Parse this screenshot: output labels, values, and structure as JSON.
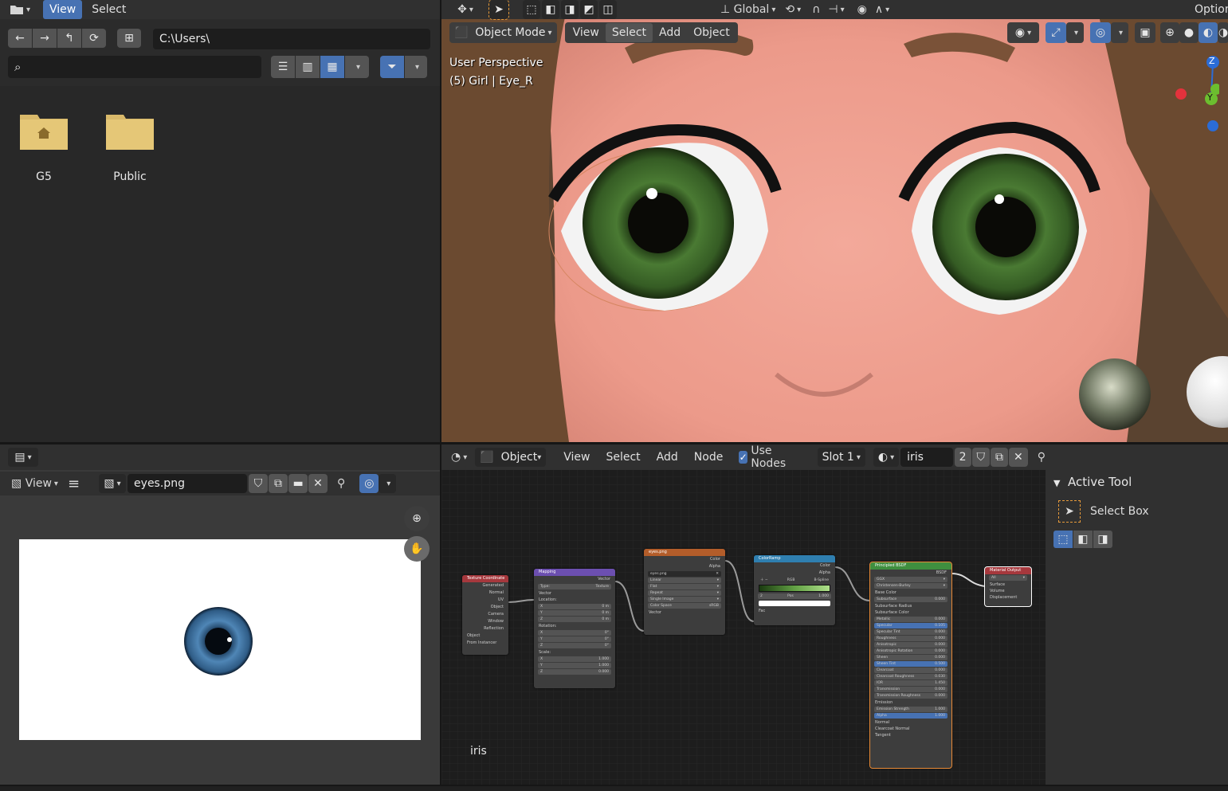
{
  "file_browser": {
    "menu": {
      "view": "View",
      "select": "Select"
    },
    "path": "C:\\Users\\",
    "search_placeholder": "",
    "folders": [
      {
        "name": "G5",
        "type": "home"
      },
      {
        "name": "Public",
        "type": "folder"
      }
    ]
  },
  "viewport": {
    "mode": "Object Mode",
    "menu": {
      "view": "View",
      "select": "Select",
      "add": "Add",
      "object": "Object"
    },
    "orientation": "Global",
    "options": "Options",
    "overlay_line1": "User Perspective",
    "overlay_line2": "(5) Girl | Eye_R",
    "gizmo": {
      "z": "Z",
      "y": "Y"
    }
  },
  "image_editor": {
    "menu": {
      "view": "View"
    },
    "image_name": "eyes.png"
  },
  "node_editor": {
    "type": "Object",
    "menu": {
      "view": "View",
      "select": "Select",
      "add": "Add",
      "node": "Node"
    },
    "use_nodes_label": "Use Nodes",
    "use_nodes_checked": true,
    "slot": "Slot 1",
    "material": "iris",
    "users": "2",
    "material_label": "iris",
    "nodes": {
      "texcoord": {
        "title": "Texture Coordinate",
        "outputs": [
          "Generated",
          "Normal",
          "UV",
          "Object",
          "Camera",
          "Window",
          "Reflection"
        ],
        "object_label": "Object",
        "from_instancer": "From Instancer"
      },
      "mapping": {
        "title": "Mapping",
        "out": "Vector",
        "type_label": "Type:",
        "type_value": "Texture",
        "vector": "Vector",
        "location": "Location:",
        "loc": [
          [
            "X",
            "0 m"
          ],
          [
            "Y",
            "0 m"
          ],
          [
            "Z",
            "0 m"
          ]
        ],
        "rotation": "Rotation:",
        "rot": [
          [
            "X",
            "0°"
          ],
          [
            "Y",
            "0°"
          ],
          [
            "Z",
            "0°"
          ]
        ],
        "scale": "Scale:",
        "scl": [
          [
            "X",
            "1.000"
          ],
          [
            "Y",
            "1.000"
          ],
          [
            "Z",
            "0.000"
          ]
        ]
      },
      "image": {
        "title": "eyes.png",
        "outputs": [
          "Color",
          "Alpha"
        ],
        "image_name": "eyes.png",
        "interp": "Linear",
        "proj": "Flat",
        "ext": "Repeat",
        "source": "Single Image",
        "cs_label": "Color Space",
        "cs_value": "sRGB",
        "vector": "Vector"
      },
      "ramp": {
        "title": "ColorRamp",
        "outputs": [
          "Color",
          "Alpha"
        ],
        "mode": "RGB",
        "interp": "B-Spline",
        "index": "2",
        "pos_label": "Pos",
        "pos_value": "1.000",
        "fac": "Fac"
      },
      "bsdf": {
        "title": "Principled BSDF",
        "out": "BSDF",
        "dist": "GGX",
        "sss": "Christensen-Burley",
        "rows": [
          [
            "Base Color",
            ""
          ],
          [
            "Subsurface",
            "0.000"
          ],
          [
            "Subsurface Radius",
            ""
          ],
          [
            "Subsurface Color",
            ""
          ],
          [
            "Metallic",
            "0.000"
          ],
          [
            "Specular",
            "0.105"
          ],
          [
            "Specular Tint",
            "0.000"
          ],
          [
            "Roughness",
            "0.000"
          ],
          [
            "Anisotropic",
            "0.000"
          ],
          [
            "Anisotropic Rotation",
            "0.000"
          ],
          [
            "Sheen",
            "0.000"
          ],
          [
            "Sheen Tint",
            "0.500"
          ],
          [
            "Clearcoat",
            "0.000"
          ],
          [
            "Clearcoat Roughness",
            "0.030"
          ],
          [
            "IOR",
            "1.450"
          ],
          [
            "Transmission",
            "0.000"
          ],
          [
            "Transmission Roughness",
            "0.000"
          ],
          [
            "Emission",
            ""
          ],
          [
            "Emission Strength",
            "1.000"
          ],
          [
            "Alpha",
            "1.000"
          ],
          [
            "Normal",
            ""
          ],
          [
            "Clearcoat Normal",
            ""
          ],
          [
            "Tangent",
            ""
          ]
        ]
      },
      "output": {
        "title": "Material Output",
        "target": "All",
        "inputs": [
          "Surface",
          "Volume",
          "Displacement"
        ]
      }
    }
  },
  "sidebar": {
    "panel_title": "Active Tool",
    "tool_name": "Select Box"
  },
  "colors": {
    "accent": "#4772b3",
    "header": "#303030",
    "area": "#2b2b2b",
    "folder": "#d9b96a"
  }
}
